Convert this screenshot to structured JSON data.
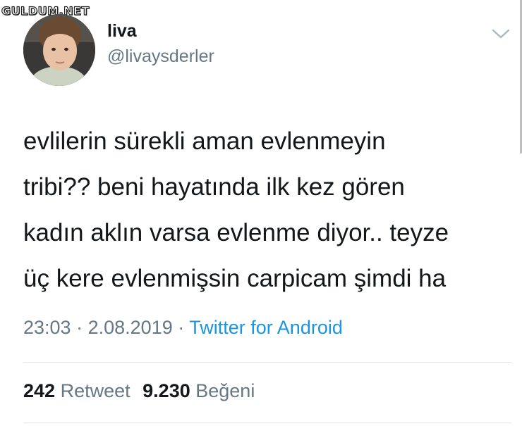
{
  "watermark": "GULDUM.NET",
  "user": {
    "display_name": "liva",
    "handle": "@livaysderler",
    "avatar": "profile-photo"
  },
  "tweet": {
    "lines": [
      "evlilerin sürekli aman evlenmeyin",
      "tribi?? beni hayatında ilk kez gören",
      "kadın aklın varsa evlenme diyor.. teyze",
      "üç kere evlenmişsin carpicam şimdi ha"
    ],
    "time": "23:03",
    "separator": "·",
    "date": "2.08.2019",
    "source": "Twitter for Android"
  },
  "stats": {
    "retweet_count": "242",
    "retweet_label": "Retweet",
    "like_count": "9.230",
    "like_label": "Beğeni"
  },
  "colors": {
    "text": "#14171a",
    "secondary": "#657786",
    "link": "#1b95e0",
    "divider": "#e1e8ed"
  },
  "icons": {
    "menu": "chevron-down-icon"
  }
}
